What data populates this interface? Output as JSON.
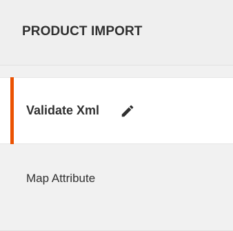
{
  "panel": {
    "title": "PRODUCT IMPORT"
  },
  "steps": [
    {
      "label": "Validate Xml",
      "state": "active",
      "icon": "pencil-icon"
    },
    {
      "label": "Map Attribute",
      "state": "inactive"
    }
  ],
  "colors": {
    "accent": "#eb5202",
    "text": "#303030",
    "panel_bg": "#f1f1f1",
    "active_bg": "#ffffff"
  }
}
